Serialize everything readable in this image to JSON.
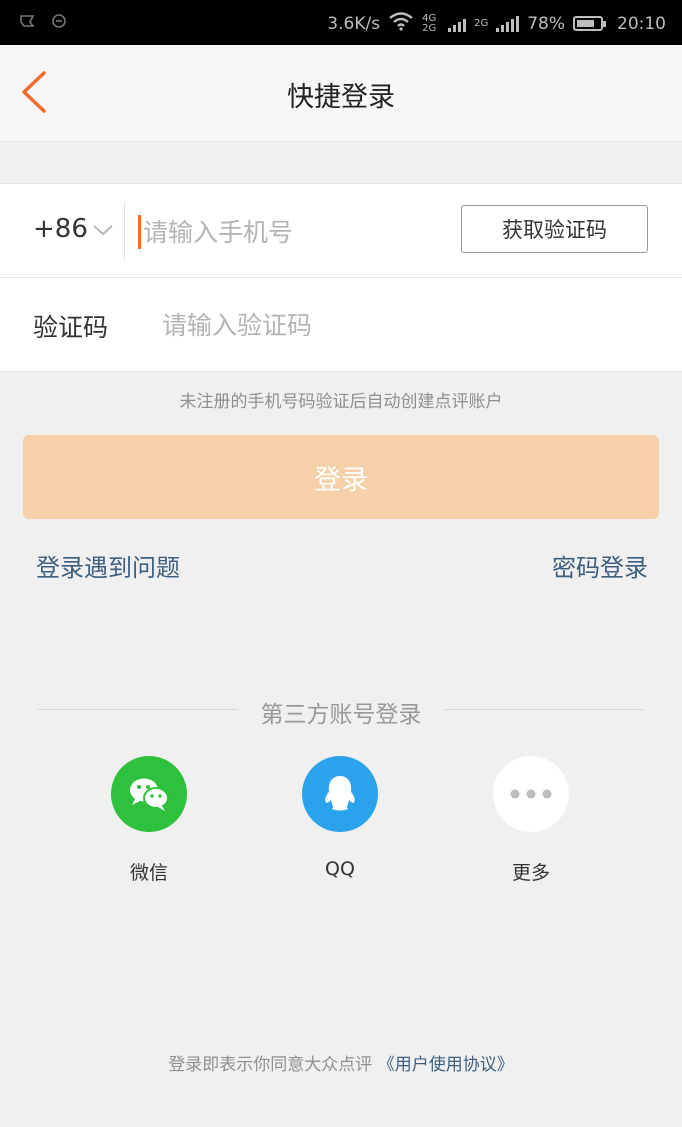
{
  "status_bar": {
    "speed": "3.6K/s",
    "network_a": "4G 2G",
    "network_b": "2G",
    "battery_percent": "78%",
    "battery_level": 0.78,
    "time": "20:10"
  },
  "nav": {
    "title": "快捷登录",
    "back_icon": "chevron-left-icon"
  },
  "form": {
    "country_code": "+86",
    "phone_placeholder": "请输入手机号",
    "phone_value": "",
    "get_code_label": "获取验证码",
    "code_label": "验证码",
    "code_placeholder": "请输入验证码",
    "code_value": ""
  },
  "hint": "未注册的手机号码验证后自动创建点评账户",
  "login_label": "登录",
  "links": {
    "problem": "登录遇到问题",
    "password_login": "密码登录"
  },
  "third_party": {
    "title": "第三方账号登录",
    "items": [
      {
        "label": "微信",
        "icon": "wechat-icon",
        "color": "#2dc13d"
      },
      {
        "label": "QQ",
        "icon": "qq-icon",
        "color": "#2ba2ec"
      },
      {
        "label": "更多",
        "icon": "more-icon",
        "color": "#ffffff"
      }
    ]
  },
  "agreement": {
    "text": "登录即表示你同意大众点评",
    "link": "《用户使用协议》"
  },
  "colors": {
    "accent": "#f26b2f",
    "login_button": "#f5d0a9",
    "link": "#3f5f7f"
  }
}
